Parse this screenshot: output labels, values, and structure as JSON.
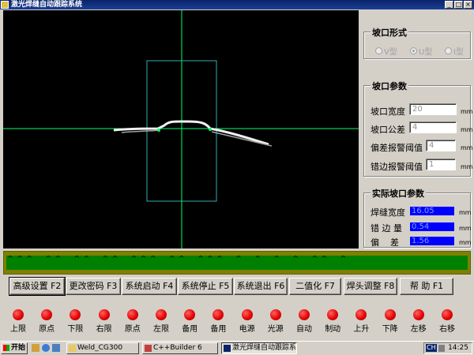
{
  "window": {
    "title": "激光焊缝自动跟踪系统",
    "minimize": "_",
    "maximize": "□",
    "close": "×"
  },
  "groove_type": {
    "title": "坡口形式",
    "options": [
      {
        "label": "V型",
        "selected": false
      },
      {
        "label": "U型",
        "selected": true
      },
      {
        "label": "I型",
        "selected": false
      }
    ]
  },
  "groove_params": {
    "title": "坡口参数",
    "fields": [
      {
        "label": "坡口宽度",
        "value": "20",
        "unit": "mm"
      },
      {
        "label": "坡口公差",
        "value": "4",
        "unit": "mm"
      },
      {
        "label": "偏差报警阈值",
        "value": "4",
        "unit": "mm"
      },
      {
        "label": "错边报警阈值",
        "value": "1",
        "unit": "mm"
      }
    ]
  },
  "actual_params": {
    "title": "实际坡口参数",
    "fields": [
      {
        "label": "焊缝宽度",
        "value": "16.05",
        "unit": "mm"
      },
      {
        "label": "错 边 量",
        "value": "0.54",
        "unit": "mm"
      },
      {
        "label": "偏    差",
        "value": "1.56",
        "unit": "mm"
      }
    ]
  },
  "status_strip": {
    "line1": "^ ^ ^   ^ ^   ^ ^   ^ ^   ^ ^ ^   ^ ^   ^ ^ ^   ^   ^   ^   ^   ^ ^   ^",
    "line2": "_ _ _ _ _ _ _ _ _ _ _ _ _ _ _ _ _ _ _ _ _ _ _ _ _ _ _ _ _ _ _ _ _ _ _"
  },
  "buttons": [
    "高级设置 F2",
    "更改密码 F3",
    "系统启动 F4",
    "系统停止 F5",
    "系统退出 F6",
    "二值化 F7",
    "焊头调整 F8",
    "帮  助 F1"
  ],
  "indicators": [
    "上限",
    "原点",
    "下限",
    "右限",
    "原点",
    "左限",
    "备用",
    "备用",
    "电源",
    "光源",
    "自动",
    "制动",
    "上升",
    "下降",
    "左移",
    "右移"
  ],
  "taskbar": {
    "start": "开始",
    "tasks": [
      {
        "label": "Weld_CG300",
        "active": false
      },
      {
        "label": "C++Builder 6",
        "active": false
      },
      {
        "label": "激光焊缝自动跟踪系统",
        "active": true
      }
    ],
    "tray_lang": "CH",
    "clock": "14:25"
  },
  "colors": {
    "indicator_red": "#e00000",
    "strip_green": "#008000",
    "strip_border": "#808000",
    "crosshair": "#00ff66",
    "roi_box": "#2fb0b0",
    "readout_blue": "#0000ff"
  }
}
